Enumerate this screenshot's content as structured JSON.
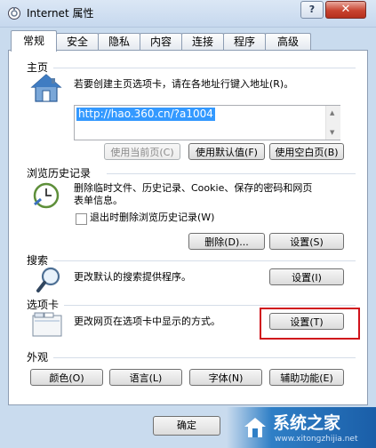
{
  "window": {
    "title": "Internet 属性",
    "help_label": "?",
    "close_label": "✕"
  },
  "tabs": [
    {
      "label": "常规",
      "active": true
    },
    {
      "label": "安全"
    },
    {
      "label": "隐私"
    },
    {
      "label": "内容"
    },
    {
      "label": "连接"
    },
    {
      "label": "程序"
    },
    {
      "label": "高级"
    }
  ],
  "home": {
    "label": "主页",
    "description": "若要创建主页选项卡，请在各地址行键入地址(R)。",
    "url": "http://hao.360.cn/?a1004",
    "use_current": "使用当前页(C)",
    "use_default": "使用默认值(F)",
    "use_blank": "使用空白页(B)"
  },
  "history": {
    "label": "浏览历史记录",
    "description_line1": "删除临时文件、历史记录、Cookie、保存的密码和网页",
    "description_line2": "表单信息。",
    "checkbox_label": "退出时删除浏览历史记录(W)",
    "delete_button": "删除(D)...",
    "settings_button": "设置(S)"
  },
  "search": {
    "label": "搜索",
    "description": "更改默认的搜索提供程序。",
    "settings_button": "设置(I)"
  },
  "tabs_section": {
    "label": "选项卡",
    "description": "更改网页在选项卡中显示的方式。",
    "settings_button": "设置(T)"
  },
  "appearance": {
    "label": "外观",
    "colors_button": "颜色(O)",
    "languages_button": "语言(L)",
    "fonts_button": "字体(N)",
    "accessibility_button": "辅助功能(E)"
  },
  "footer": {
    "ok_button": "确定"
  },
  "watermark": {
    "brand": "系统之家",
    "sub": "www.xitongzhijia.net"
  },
  "colors": {
    "highlight": "#d0121b",
    "selection": "#3399ff",
    "window_frame": "#c9dbee"
  }
}
